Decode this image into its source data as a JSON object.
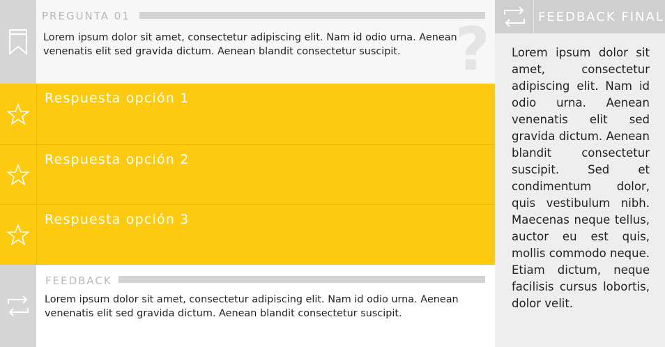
{
  "question": {
    "heading": "PREGUNTA 01",
    "text": "Lorem ipsum dolor sit amet, consectetur adipiscing elit. Nam id odio urna. Aenean venenatis elit sed gravida dictum. Aenean blandit consectetur suscipit.",
    "watermark": "?"
  },
  "answers": [
    {
      "label": "Respuesta opción 1",
      "icon": "star-icon"
    },
    {
      "label": "Respuesta opción 2",
      "icon": "star-icon"
    },
    {
      "label": "Respuesta opción 3",
      "icon": "star-icon"
    }
  ],
  "feedback": {
    "heading": "FEEDBACK",
    "text": "Lorem ipsum dolor sit amet, consectetur adipiscing elit. Nam id odio urna. Aenean venenatis elit sed gravida dictum. Aenean blandit consectetur suscipit."
  },
  "final_feedback": {
    "title": "FEEDBACK FINAL",
    "text": "Lorem ipsum dolor sit amet, consectetur adipiscing elit. Nam id odio urna. Aenean venenatis elit sed gravida dictum. Aenean blandit consectetur suscipit. Sed et condimentum dolor, quis vestibulum nibh. Maecenas neque tellus, auctor eu est quis, mollis commodo neque. Etiam dictum, neque facilisis cursus lobortis, dolor velit."
  },
  "icons": {
    "question": "bookmark-icon",
    "feedback": "repeat-icon",
    "final_feedback": "repeat-icon"
  },
  "colors": {
    "accent": "#fdca0f",
    "rail": "#d5d5d5",
    "panel": "#eeeeee"
  }
}
